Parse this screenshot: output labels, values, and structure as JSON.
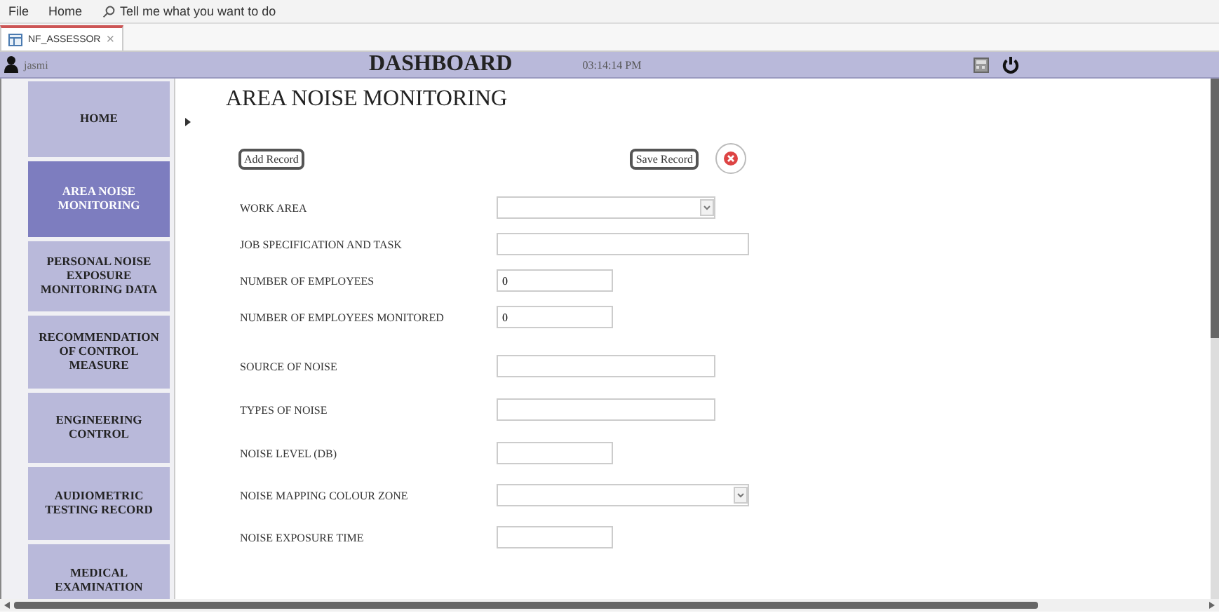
{
  "ribbon": {
    "menus": [
      "File",
      "Home"
    ],
    "search": {
      "placeholder": "Tell me what you want to do"
    }
  },
  "doc_tab": {
    "label": "NF_ASSESSOR",
    "close": "×"
  },
  "header": {
    "user": "jasmi",
    "title": "DASHBOARD",
    "time": "03:14:14 PM"
  },
  "sidebar": {
    "items": [
      {
        "label": "HOME",
        "selected": false
      },
      {
        "label": "AREA NOISE MONITORING",
        "selected": true
      },
      {
        "label": "PERSONAL NOISE EXPOSURE MONITORING DATA",
        "selected": false
      },
      {
        "label": "RECOMMENDATION OF CONTROL MEASURE",
        "selected": false
      },
      {
        "label": "ENGINEERING CONTROL",
        "selected": false
      },
      {
        "label": "AUDIOMETRIC TESTING RECORD",
        "selected": false
      },
      {
        "label": "MEDICAL EXAMINATION",
        "selected": false
      }
    ]
  },
  "form": {
    "title": "AREA NOISE MONITORING",
    "add_button": "Add Record",
    "save_button": "Save Record",
    "fields": [
      {
        "label": "WORK AREA",
        "kind": "dropdown"
      },
      {
        "label": "JOB SPECIFICATION AND TASK",
        "kind": "text"
      },
      {
        "label": "NUMBER OF EMPLOYEES",
        "kind": "text",
        "value": "0"
      },
      {
        "label": "NUMBER OF EMPLOYEES MONITORED",
        "kind": "text",
        "value": "0"
      },
      {
        "label": "SOURCE OF NOISE",
        "kind": "text"
      },
      {
        "label": "TYPES OF NOISE",
        "kind": "text"
      },
      {
        "label": "NOISE LEVEL (DB)",
        "kind": "text"
      },
      {
        "label": "NOISE MAPPING COLOUR ZONE",
        "kind": "dropdown"
      },
      {
        "label": "NOISE EXPOSURE TIME",
        "kind": "text"
      }
    ]
  }
}
